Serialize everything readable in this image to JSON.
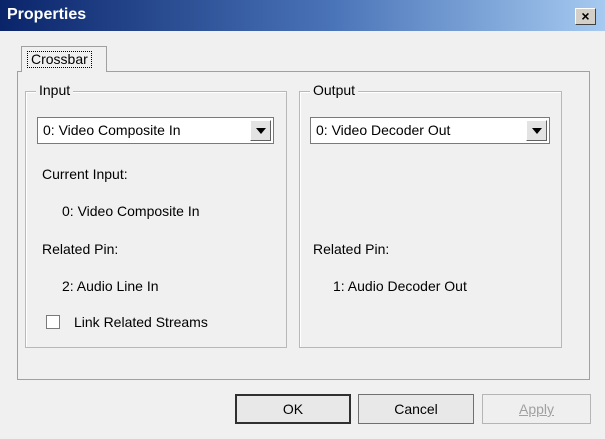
{
  "window": {
    "title": "Properties",
    "close_glyph": "×"
  },
  "tabs": [
    {
      "label": "Crossbar",
      "selected": true
    }
  ],
  "input_group": {
    "legend": "Input",
    "select_value": "0: Video Composite In",
    "current_input_label": "Current Input:",
    "current_input_value": "0: Video Composite In",
    "related_pin_label": "Related Pin:",
    "related_pin_value": "2: Audio Line In",
    "link_checkbox_label": "Link Related Streams",
    "link_checkbox_checked": false
  },
  "output_group": {
    "legend": "Output",
    "select_value": "0: Video Decoder Out",
    "related_pin_label": "Related Pin:",
    "related_pin_value": "1: Audio Decoder Out"
  },
  "buttons": {
    "ok": "OK",
    "cancel": "Cancel",
    "apply": "Apply"
  },
  "icons": {
    "close": "close-icon",
    "dropdown": "chevron-down-icon"
  },
  "colors": {
    "titlebar_start": "#0a246a",
    "titlebar_end": "#a6caf0",
    "face": "#f0f0f0"
  }
}
